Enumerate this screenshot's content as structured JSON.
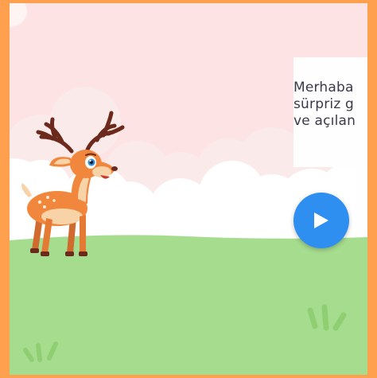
{
  "speech": {
    "lines": [
      "Merhaba",
      "sürpriz g",
      "ve açılan"
    ]
  },
  "play_button": {
    "icon": "play-icon"
  },
  "colors": {
    "frame": "#ffa04e",
    "sky": "#fde3e4",
    "cloud": "#ffffff",
    "grass": "#a6dc8e",
    "grass_tuft": "#8fcf72",
    "play_button": "#2f8ff0",
    "speech_text": "#3a3a4a"
  },
  "characters": {
    "deer": "deer-illustration"
  }
}
